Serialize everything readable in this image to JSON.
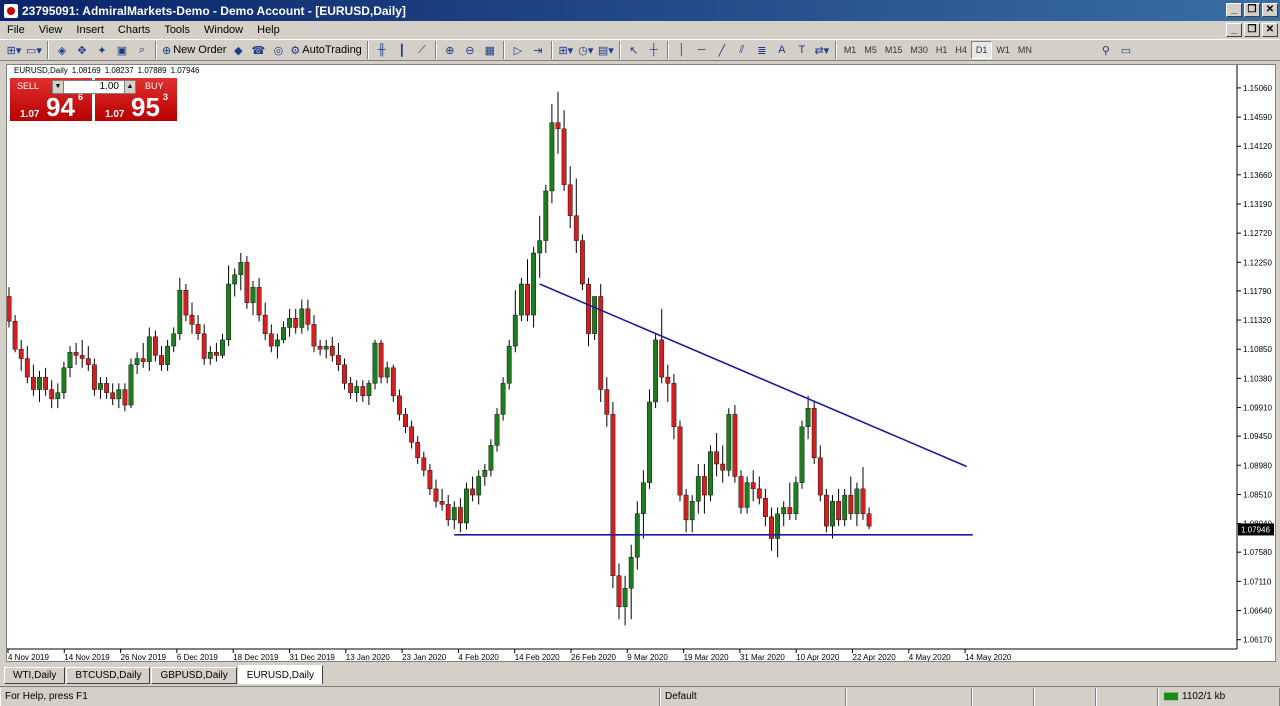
{
  "window": {
    "title": "23795091: AdmiralMarkets-Demo - Demo Account - [EURUSD,Daily]"
  },
  "menu": [
    "File",
    "View",
    "Insert",
    "Charts",
    "Tools",
    "Window",
    "Help"
  ],
  "toolbar": {
    "new_order": "New Order",
    "autotrading": "AutoTrading",
    "timeframes": [
      "M1",
      "M5",
      "M15",
      "M30",
      "H1",
      "H4",
      "D1",
      "W1",
      "MN"
    ],
    "active_timeframe": "D1"
  },
  "chart_header": {
    "symbol": "EURUSD,Daily",
    "open": "1.08169",
    "high": "1.08237",
    "low": "1.07889",
    "close": "1.07946"
  },
  "trade_panel": {
    "sell_label": "SELL",
    "buy_label": "BUY",
    "lot": "1.00",
    "sell_small": "1.07",
    "sell_big": "94",
    "sell_sup": "6",
    "buy_small": "1.07",
    "buy_big": "95",
    "buy_sup": "3"
  },
  "chart_data": {
    "type": "candlestick",
    "symbol": "EURUSD",
    "timeframe": "Daily",
    "y_ticks": [
      "1.15060",
      "1.14590",
      "1.14120",
      "1.13660",
      "1.13190",
      "1.12720",
      "1.12250",
      "1.11790",
      "1.11320",
      "1.10850",
      "1.10380",
      "1.09910",
      "1.09450",
      "1.08980",
      "1.08510",
      "1.08040",
      "1.07580",
      "1.07110",
      "1.06640",
      "1.06170"
    ],
    "current_price": "1.07946",
    "x_ticks": [
      "4 Nov 2019",
      "14 Nov 2019",
      "26 Nov 2019",
      "6 Dec 2019",
      "18 Dec 2019",
      "31 Dec 2019",
      "13 Jan 2020",
      "23 Jan 2020",
      "4 Feb 2020",
      "14 Feb 2020",
      "26 Feb 2020",
      "9 Mar 2020",
      "19 Mar 2020",
      "31 Mar 2020",
      "10 Apr 2020",
      "22 Apr 2020",
      "4 May 2020",
      "14 May 2020"
    ],
    "ylim": [
      1.0602,
      1.153
    ],
    "colors": {
      "bull": "#1e7b1e",
      "bear": "#d02020",
      "trendline": "#1a1aa0"
    },
    "candles": [
      [
        1.117,
        1.1185,
        1.112,
        1.113
      ],
      [
        1.113,
        1.114,
        1.108,
        1.1085
      ],
      [
        1.1085,
        1.11,
        1.105,
        1.107
      ],
      [
        1.107,
        1.109,
        1.103,
        1.104
      ],
      [
        1.104,
        1.106,
        1.101,
        1.102
      ],
      [
        1.102,
        1.105,
        1.1,
        1.104
      ],
      [
        1.104,
        1.1055,
        1.101,
        1.102
      ],
      [
        1.102,
        1.1035,
        1.099,
        1.1005
      ],
      [
        1.1005,
        1.103,
        1.099,
        1.1015
      ],
      [
        1.1015,
        1.1065,
        1.1005,
        1.1055
      ],
      [
        1.1055,
        1.109,
        1.104,
        1.108
      ],
      [
        1.108,
        1.1095,
        1.106,
        1.1075
      ],
      [
        1.1075,
        1.11,
        1.1055,
        1.107
      ],
      [
        1.107,
        1.109,
        1.105,
        1.106
      ],
      [
        1.106,
        1.107,
        1.101,
        1.102
      ],
      [
        1.102,
        1.104,
        1.1005,
        1.103
      ],
      [
        1.103,
        1.104,
        1.1005,
        1.1015
      ],
      [
        1.1015,
        1.103,
        1.0995,
        1.1005
      ],
      [
        1.1005,
        1.103,
        1.099,
        1.102
      ],
      [
        1.102,
        1.103,
        1.0985,
        1.0995
      ],
      [
        1.0995,
        1.107,
        1.099,
        1.106
      ],
      [
        1.106,
        1.108,
        1.1045,
        1.107
      ],
      [
        1.107,
        1.1095,
        1.1055,
        1.1065
      ],
      [
        1.1065,
        1.112,
        1.105,
        1.1105
      ],
      [
        1.1105,
        1.1115,
        1.1065,
        1.1075
      ],
      [
        1.1075,
        1.109,
        1.105,
        1.106
      ],
      [
        1.106,
        1.11,
        1.105,
        1.109
      ],
      [
        1.109,
        1.112,
        1.108,
        1.111
      ],
      [
        1.111,
        1.12,
        1.11,
        1.118
      ],
      [
        1.118,
        1.119,
        1.113,
        1.114
      ],
      [
        1.114,
        1.116,
        1.111,
        1.1125
      ],
      [
        1.1125,
        1.114,
        1.11,
        1.111
      ],
      [
        1.111,
        1.1125,
        1.106,
        1.107
      ],
      [
        1.107,
        1.109,
        1.106,
        1.108
      ],
      [
        1.108,
        1.1095,
        1.1065,
        1.1075
      ],
      [
        1.1075,
        1.111,
        1.107,
        1.11
      ],
      [
        1.11,
        1.122,
        1.109,
        1.119
      ],
      [
        1.119,
        1.1215,
        1.117,
        1.1205
      ],
      [
        1.1205,
        1.124,
        1.118,
        1.1225
      ],
      [
        1.1225,
        1.1235,
        1.115,
        1.116
      ],
      [
        1.116,
        1.1195,
        1.114,
        1.1185
      ],
      [
        1.1185,
        1.12,
        1.113,
        1.114
      ],
      [
        1.114,
        1.116,
        1.11,
        1.111
      ],
      [
        1.111,
        1.1125,
        1.108,
        1.109
      ],
      [
        1.109,
        1.111,
        1.107,
        1.11
      ],
      [
        1.11,
        1.113,
        1.1095,
        1.112
      ],
      [
        1.112,
        1.115,
        1.1105,
        1.1135
      ],
      [
        1.1135,
        1.115,
        1.111,
        1.112
      ],
      [
        1.112,
        1.1165,
        1.111,
        1.115
      ],
      [
        1.115,
        1.1165,
        1.1115,
        1.1125
      ],
      [
        1.1125,
        1.114,
        1.108,
        1.109
      ],
      [
        1.109,
        1.11,
        1.1075,
        1.1085
      ],
      [
        1.1085,
        1.11,
        1.107,
        1.109
      ],
      [
        1.109,
        1.1105,
        1.1065,
        1.1075
      ],
      [
        1.1075,
        1.1095,
        1.105,
        1.106
      ],
      [
        1.106,
        1.107,
        1.102,
        1.103
      ],
      [
        1.103,
        1.104,
        1.1005,
        1.1015
      ],
      [
        1.1015,
        1.1035,
        1.1,
        1.1025
      ],
      [
        1.1025,
        1.1035,
        1.1,
        1.101
      ],
      [
        1.101,
        1.1035,
        1.0995,
        1.103
      ],
      [
        1.103,
        1.11,
        1.102,
        1.1095
      ],
      [
        1.1095,
        1.11,
        1.103,
        1.104
      ],
      [
        1.104,
        1.1065,
        1.103,
        1.1055
      ],
      [
        1.1055,
        1.106,
        1.1,
        1.101
      ],
      [
        1.101,
        1.102,
        1.097,
        1.098
      ],
      [
        1.098,
        1.099,
        1.095,
        1.096
      ],
      [
        1.096,
        1.097,
        1.0925,
        1.0935
      ],
      [
        1.0935,
        1.0945,
        1.09,
        1.091
      ],
      [
        1.091,
        1.092,
        1.088,
        1.089
      ],
      [
        1.089,
        1.09,
        1.085,
        1.086
      ],
      [
        1.086,
        1.0875,
        1.083,
        1.084
      ],
      [
        1.084,
        1.086,
        1.0825,
        1.0835
      ],
      [
        1.0835,
        1.085,
        1.08,
        1.081
      ],
      [
        1.081,
        1.084,
        1.0795,
        1.083
      ],
      [
        1.083,
        1.0845,
        1.079,
        1.0805
      ],
      [
        1.0805,
        1.087,
        1.0795,
        1.086
      ],
      [
        1.086,
        1.088,
        1.084,
        1.085
      ],
      [
        1.085,
        1.089,
        1.0835,
        1.088
      ],
      [
        1.088,
        1.09,
        1.0865,
        1.089
      ],
      [
        1.089,
        1.094,
        1.088,
        1.093
      ],
      [
        1.093,
        1.099,
        1.092,
        1.098
      ],
      [
        1.098,
        1.104,
        1.097,
        1.103
      ],
      [
        1.103,
        1.11,
        1.102,
        1.109
      ],
      [
        1.109,
        1.118,
        1.108,
        1.114
      ],
      [
        1.114,
        1.12,
        1.113,
        1.119
      ],
      [
        1.119,
        1.123,
        1.113,
        1.114
      ],
      [
        1.114,
        1.125,
        1.112,
        1.124
      ],
      [
        1.124,
        1.13,
        1.12,
        1.126
      ],
      [
        1.126,
        1.135,
        1.124,
        1.134
      ],
      [
        1.134,
        1.148,
        1.132,
        1.145
      ],
      [
        1.145,
        1.15,
        1.14,
        1.144
      ],
      [
        1.144,
        1.147,
        1.134,
        1.135
      ],
      [
        1.135,
        1.138,
        1.128,
        1.13
      ],
      [
        1.13,
        1.136,
        1.124,
        1.126
      ],
      [
        1.126,
        1.127,
        1.118,
        1.119
      ],
      [
        1.119,
        1.12,
        1.109,
        1.111
      ],
      [
        1.111,
        1.116,
        1.11,
        1.117
      ],
      [
        1.117,
        1.119,
        1.1,
        1.102
      ],
      [
        1.102,
        1.104,
        1.096,
        1.098
      ],
      [
        1.098,
        1.1,
        1.07,
        1.072
      ],
      [
        1.072,
        1.074,
        1.065,
        1.067
      ],
      [
        1.067,
        1.072,
        1.064,
        1.07
      ],
      [
        1.07,
        1.077,
        1.065,
        1.075
      ],
      [
        1.075,
        1.084,
        1.073,
        1.082
      ],
      [
        1.082,
        1.089,
        1.078,
        1.087
      ],
      [
        1.087,
        1.102,
        1.086,
        1.1
      ],
      [
        1.1,
        1.111,
        1.099,
        1.11
      ],
      [
        1.11,
        1.115,
        1.103,
        1.104
      ],
      [
        1.104,
        1.106,
        1.1,
        1.103
      ],
      [
        1.103,
        1.1045,
        1.094,
        1.096
      ],
      [
        1.096,
        1.097,
        1.084,
        1.085
      ],
      [
        1.085,
        1.086,
        1.079,
        1.081
      ],
      [
        1.081,
        1.085,
        1.079,
        1.084
      ],
      [
        1.084,
        1.09,
        1.082,
        1.088
      ],
      [
        1.088,
        1.09,
        1.082,
        1.085
      ],
      [
        1.085,
        1.093,
        1.084,
        1.092
      ],
      [
        1.092,
        1.095,
        1.088,
        1.09
      ],
      [
        1.09,
        1.093,
        1.087,
        1.089
      ],
      [
        1.089,
        1.099,
        1.088,
        1.098
      ],
      [
        1.098,
        1.0995,
        1.087,
        1.088
      ],
      [
        1.088,
        1.089,
        1.082,
        1.083
      ],
      [
        1.083,
        1.088,
        1.082,
        1.087
      ],
      [
        1.087,
        1.089,
        1.084,
        1.086
      ],
      [
        1.086,
        1.088,
        1.0835,
        1.0845
      ],
      [
        1.0845,
        1.086,
        1.08,
        1.0815
      ],
      [
        1.0815,
        1.083,
        1.076,
        1.078
      ],
      [
        1.078,
        1.083,
        1.075,
        1.082
      ],
      [
        1.082,
        1.084,
        1.08,
        1.083
      ],
      [
        1.083,
        1.087,
        1.081,
        1.082
      ],
      [
        1.082,
        1.088,
        1.081,
        1.087
      ],
      [
        1.087,
        1.097,
        1.086,
        1.096
      ],
      [
        1.096,
        1.101,
        1.094,
        1.099
      ],
      [
        1.099,
        1.1,
        1.09,
        1.091
      ],
      [
        1.091,
        1.093,
        1.084,
        1.085
      ],
      [
        1.085,
        1.086,
        1.079,
        1.08
      ],
      [
        1.08,
        1.085,
        1.078,
        1.084
      ],
      [
        1.084,
        1.086,
        1.08,
        1.081
      ],
      [
        1.081,
        1.086,
        1.08,
        1.085
      ],
      [
        1.085,
        1.088,
        1.081,
        1.082
      ],
      [
        1.082,
        1.087,
        1.08,
        1.086
      ],
      [
        1.086,
        1.0895,
        1.081,
        1.082
      ],
      [
        1.082,
        1.083,
        1.0795,
        1.08
      ]
    ],
    "trendlines": [
      {
        "name": "descending-resistance",
        "x1": 1.119,
        "y1_index": 87,
        "y2": 1.0896,
        "x2_index": 157
      },
      {
        "name": "horizontal-support",
        "y": 1.0786,
        "x1_index": 73,
        "x2_index": 158
      }
    ]
  },
  "tabs": [
    "WTI,Daily",
    "BTCUSD,Daily",
    "GBPUSD,Daily",
    "EURUSD,Daily"
  ],
  "active_tab": "EURUSD,Daily",
  "status": {
    "help": "For Help, press F1",
    "profile": "Default",
    "traffic": "1102/1 kb"
  }
}
